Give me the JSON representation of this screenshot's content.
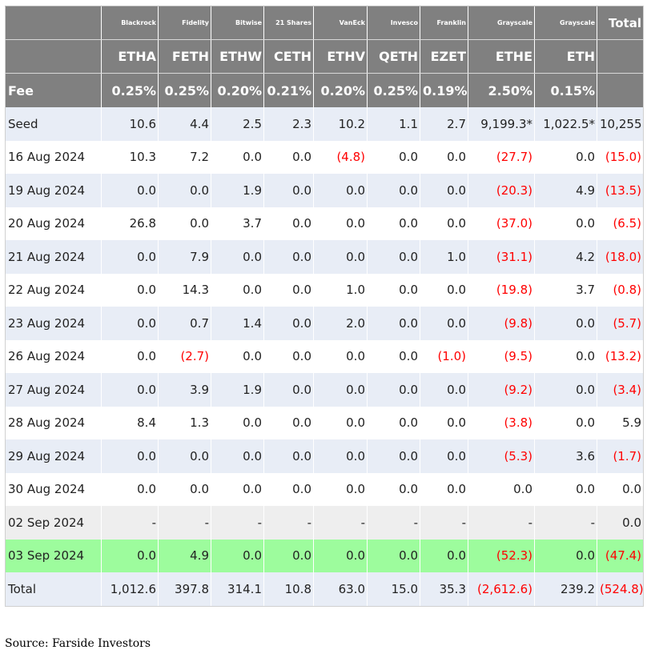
{
  "table": {
    "issuers": [
      "",
      "Blackrock",
      "Fidelity",
      "Bitwise",
      "21 Shares",
      "VanEck",
      "Invesco",
      "Franklin",
      "Grayscale",
      "Grayscale",
      "Total"
    ],
    "tickers": [
      "",
      "ETHA",
      "FETH",
      "ETHW",
      "CETH",
      "ETHV",
      "QETH",
      "EZET",
      "ETHE",
      "ETH",
      ""
    ],
    "fees": [
      "Fee",
      "0.25%",
      "0.25%",
      "0.20%",
      "0.21%",
      "0.20%",
      "0.25%",
      "0.19%",
      "2.50%",
      "0.15%",
      ""
    ],
    "rows": [
      [
        "Seed",
        "10.6",
        "4.4",
        "2.5",
        "2.3",
        "10.2",
        "1.1",
        "2.7",
        "9,199.3*",
        "1,022.5*",
        "10,255"
      ],
      [
        "16 Aug 2024",
        "10.3",
        "7.2",
        "0.0",
        "0.0",
        "(4.8)",
        "0.0",
        "0.0",
        "(27.7)",
        "0.0",
        "(15.0)"
      ],
      [
        "19 Aug 2024",
        "0.0",
        "0.0",
        "1.9",
        "0.0",
        "0.0",
        "0.0",
        "0.0",
        "(20.3)",
        "4.9",
        "(13.5)"
      ],
      [
        "20 Aug 2024",
        "26.8",
        "0.0",
        "3.7",
        "0.0",
        "0.0",
        "0.0",
        "0.0",
        "(37.0)",
        "0.0",
        "(6.5)"
      ],
      [
        "21 Aug 2024",
        "0.0",
        "7.9",
        "0.0",
        "0.0",
        "0.0",
        "0.0",
        "1.0",
        "(31.1)",
        "4.2",
        "(18.0)"
      ],
      [
        "22 Aug 2024",
        "0.0",
        "14.3",
        "0.0",
        "0.0",
        "1.0",
        "0.0",
        "0.0",
        "(19.8)",
        "3.7",
        "(0.8)"
      ],
      [
        "23 Aug 2024",
        "0.0",
        "0.7",
        "1.4",
        "0.0",
        "2.0",
        "0.0",
        "0.0",
        "(9.8)",
        "0.0",
        "(5.7)"
      ],
      [
        "26 Aug 2024",
        "0.0",
        "(2.7)",
        "0.0",
        "0.0",
        "0.0",
        "0.0",
        "(1.0)",
        "(9.5)",
        "0.0",
        "(13.2)"
      ],
      [
        "27 Aug 2024",
        "0.0",
        "3.9",
        "1.9",
        "0.0",
        "0.0",
        "0.0",
        "0.0",
        "(9.2)",
        "0.0",
        "(3.4)"
      ],
      [
        "28 Aug 2024",
        "8.4",
        "1.3",
        "0.0",
        "0.0",
        "0.0",
        "0.0",
        "0.0",
        "(3.8)",
        "0.0",
        "5.9"
      ],
      [
        "29 Aug 2024",
        "0.0",
        "0.0",
        "0.0",
        "0.0",
        "0.0",
        "0.0",
        "0.0",
        "(5.3)",
        "3.6",
        "(1.7)"
      ],
      [
        "30 Aug 2024",
        "0.0",
        "0.0",
        "0.0",
        "0.0",
        "0.0",
        "0.0",
        "0.0",
        "0.0",
        "0.0",
        "0.0"
      ],
      [
        "02 Sep 2024",
        "-",
        "-",
        "-",
        "-",
        "-",
        "-",
        "-",
        "-",
        "-",
        "0.0"
      ],
      [
        "03 Sep 2024",
        "0.0",
        "4.9",
        "0.0",
        "0.0",
        "0.0",
        "0.0",
        "0.0",
        "(52.3)",
        "0.0",
        "(47.4)"
      ],
      [
        "Total",
        "1,012.6",
        "397.8",
        "314.1",
        "10.8",
        "63.0",
        "15.0",
        "35.3",
        "(2,612.6)",
        "239.2",
        "(524.8)"
      ]
    ]
  },
  "footer": {
    "source": "Source: Farside Investors"
  },
  "colors": {
    "header_bg": "#808080",
    "stripe_bg": "#e8edf6",
    "highlight_bg": "#9dfc9d",
    "negative_text": "#ff0000"
  }
}
